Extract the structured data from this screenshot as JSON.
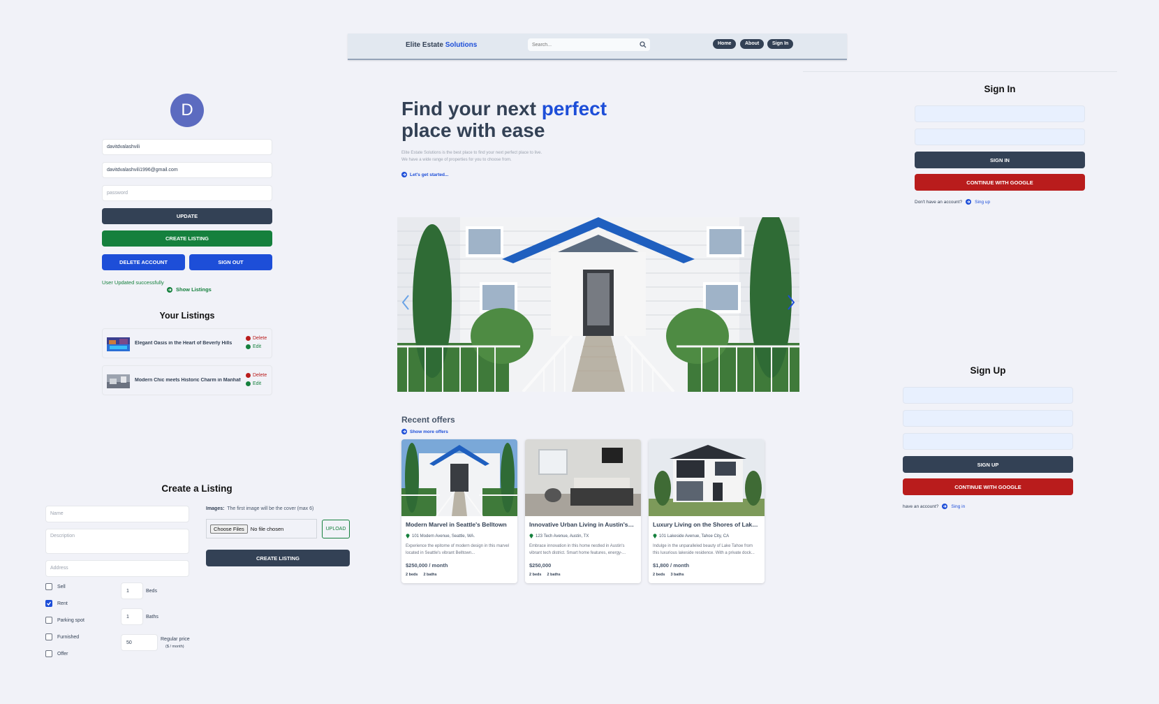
{
  "header": {
    "brand_part1": "Elite Estate",
    "brand_part2": "Solutions",
    "search_placeholder": "Search...",
    "nav": [
      "Home",
      "About",
      "Sign In"
    ]
  },
  "profile": {
    "avatar_letter": "D",
    "username": "davitdvalashvili",
    "email": "davitdvalashvili1996@gmail.com",
    "password_placeholder": "password",
    "update_label": "UPDATE",
    "create_listing_label": "CREATE LISTING",
    "delete_account_label": "DELETE ACCOUNT",
    "sign_out_label": "SIGN OUT",
    "message": "User Updated successfully",
    "show_listings_label": "Show Listings",
    "your_listings_title": "Your Listings",
    "listings": [
      {
        "title": "Elegant Oasis in the Heart of Beverly Hills",
        "delete": "Delete",
        "edit": "Edit"
      },
      {
        "title": "Modern Chic meets Historic Charm in Manhattan",
        "delete": "Delete",
        "edit": "Edit"
      }
    ]
  },
  "hero": {
    "title_part1": "Find your next ",
    "title_highlight": "perfect",
    "title_part2": "place with ease",
    "subtitle_line1": "Elite Estate Solutions is the best place to find your next perfect place to live.",
    "subtitle_line2": "We have a wide range of properties for you to choose from.",
    "cta": "Let's get started..."
  },
  "offers": {
    "title": "Recent offers",
    "show_more": "Show more offers",
    "cards": [
      {
        "title": "Modern Marvel in Seattle's Belltown",
        "address": "101 Modern Avenue, Seattle, WA.",
        "desc": "Experience the epitome of modern design in this marvel located in Seattle's vibrant Belltown...",
        "price": "$250,000 / month",
        "beds": "2 beds",
        "baths": "2 baths"
      },
      {
        "title": "Innovative Urban Living in Austin's Tech District",
        "address": "123 Tech Avenue, Austin, TX",
        "desc": "Embrace innovation in this home nestled in Austin's vibrant tech district. Smart home features, energy-...",
        "price": "$250,000",
        "beds": "2 beds",
        "baths": "2 baths"
      },
      {
        "title": "Luxury Living on the Shores of Lake Tahoe",
        "address": "101 Lakeside Avenue, Tahoe City, CA",
        "desc": "Indulge in the unparalleled beauty of Lake Tahoe from this luxurious lakeside residence. With a private dock...",
        "price": "$1,800 / month",
        "beds": "2 beds",
        "baths": "3 baths"
      }
    ]
  },
  "signin": {
    "title": "Sign In",
    "submit": "SIGN IN",
    "google": "CONTINUE WITH GOOGLE",
    "prompt": "Don't have an account?",
    "link": "Sing up"
  },
  "signup": {
    "title": "Sign Up",
    "submit": "SIGN UP",
    "google": "CONTINUE WITH GOOGLE",
    "prompt": "have an account?",
    "link": "Sing in"
  },
  "create": {
    "title": "Create a Listing",
    "name_placeholder": "Name",
    "description_placeholder": "Description",
    "address_placeholder": "Address",
    "checkboxes": [
      {
        "label": "Sell",
        "checked": false
      },
      {
        "label": "Rent",
        "checked": true
      },
      {
        "label": "Parking spot",
        "checked": false
      },
      {
        "label": "Furnished",
        "checked": false
      },
      {
        "label": "Offer",
        "checked": false
      }
    ],
    "beds_value": "1",
    "beds_label": "Beds",
    "baths_value": "1",
    "baths_label": "Baths",
    "price_value": "50",
    "price_label": "Regular price",
    "price_unit": "($ / month)",
    "images_label": "Images:",
    "images_hint": "The first image will be the cover (max 6)",
    "choose_files": "Choose Files",
    "no_file": "No file chosen",
    "upload": "UPLOAD",
    "submit": "CREATE LISTING"
  },
  "colors": {
    "slate": "#334155",
    "blue": "#1d4ed8",
    "green": "#15803d",
    "red": "#b91c1c"
  }
}
